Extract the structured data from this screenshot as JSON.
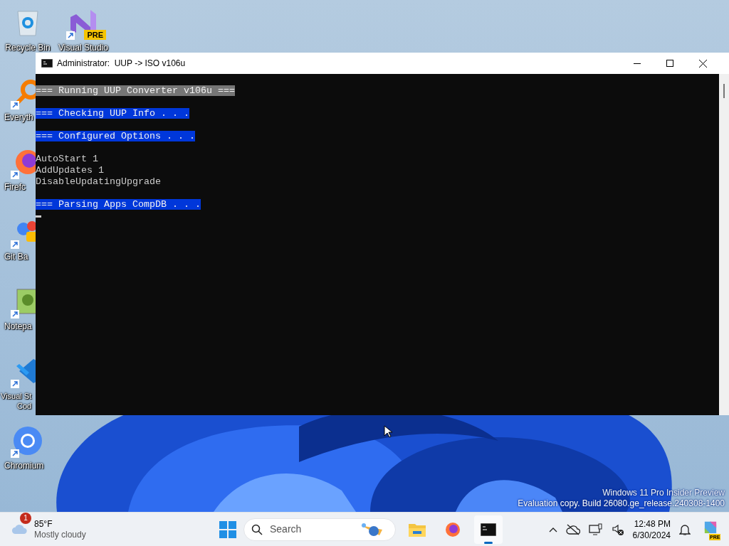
{
  "desktop_icons": [
    {
      "label": "Recycle Bin",
      "kind": "bin",
      "shortcut": false
    },
    {
      "label": "Visual Studio",
      "kind": "vs",
      "shortcut": true
    },
    {
      "label": "Everyth",
      "kind": "search",
      "shortcut": true
    },
    {
      "label": "Firefc",
      "kind": "firefox",
      "shortcut": true
    },
    {
      "label": "Git Ba",
      "kind": "git",
      "shortcut": true
    },
    {
      "label": "Notepa",
      "kind": "notepad",
      "shortcut": true
    },
    {
      "label": "Visual St",
      "label2": "Cod",
      "kind": "vscode",
      "shortcut": true
    },
    {
      "label": "Chromium",
      "kind": "chromium",
      "shortcut": true
    }
  ],
  "vs_badge": "PRE",
  "window": {
    "title": "Administrator:  UUP -> ISO v106u"
  },
  "console_lines": [
    {
      "kind": "highlight",
      "color": "#767676",
      "text": "=== Running UUP Converter v106u ==="
    },
    {
      "kind": "blank"
    },
    {
      "kind": "highlight",
      "color": "#0037da",
      "text": "=== Checking UUP Info . . ."
    },
    {
      "kind": "blank"
    },
    {
      "kind": "highlight",
      "color": "#0037da",
      "text": "=== Configured Options . . ."
    },
    {
      "kind": "blank"
    },
    {
      "kind": "plain",
      "text": "AutoStart 1"
    },
    {
      "kind": "plain",
      "text": "AddUpdates 1"
    },
    {
      "kind": "plain",
      "text": "DisableUpdatingUpgrade"
    },
    {
      "kind": "blank"
    },
    {
      "kind": "highlight",
      "color": "#0037da",
      "text": "=== Parsing Apps CompDB . . ."
    },
    {
      "kind": "cursor"
    }
  ],
  "os_watermark": [
    "Windows 11 Pro Insider Preview",
    "Evaluation copy. Build 26080.ge_release.240308-1400"
  ],
  "taskbar": {
    "weather": {
      "badge": "1",
      "temperature": "85°F",
      "condition": "Mostly cloudy"
    },
    "search": {
      "placeholder": "Search"
    },
    "apps": [
      {
        "kind": "explorer",
        "selected": false
      },
      {
        "kind": "firefox",
        "selected": false
      },
      {
        "kind": "terminal",
        "selected": true
      }
    ],
    "clock": {
      "time": "12:48 PM",
      "date": "6/30/2024"
    },
    "copilot_badge": "PRE"
  }
}
